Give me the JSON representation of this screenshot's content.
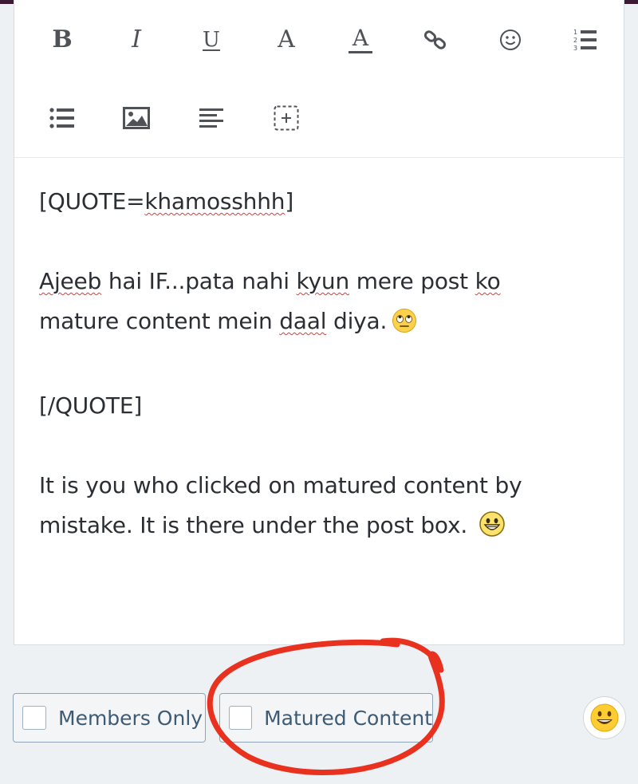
{
  "toolbar": {
    "bold": "B",
    "italic": "I",
    "underline": "U",
    "font_size": "A",
    "text_color": "A"
  },
  "content": {
    "quote_open_prefix": "[QUOTE=",
    "quote_user": "khamosshhh",
    "quote_open_suffix": "]",
    "line1_w1": "Ajeeb",
    "line1_t1": " hai IF...pata nahi ",
    "line1_w2": "kyun",
    "line1_t2": " mere post ",
    "line1_w3": "ko",
    "line2_t1": "mature content mein ",
    "line2_w1": "daal",
    "line2_t2": " diya.",
    "quote_close": "[/QUOTE]",
    "reply_line1": "It is you who clicked on matured content by",
    "reply_line2": "mistake. It is there under the post box."
  },
  "options": {
    "members_only_label": "Members Only",
    "matured_content_label": "Matured Content"
  },
  "colors": {
    "accent_border": "#8fa4b6",
    "annotation_red": "#e8321f",
    "spellcheck_red": "#e53935",
    "top_bar": "#3b1a33"
  },
  "icons": [
    "bold-icon",
    "italic-icon",
    "underline-icon",
    "font-size-icon",
    "text-color-icon",
    "link-icon",
    "smiley-icon",
    "ordered-list-icon",
    "bullet-list-icon",
    "image-icon",
    "align-icon",
    "insert-box-icon",
    "rolling-eyes-emoji",
    "grin-emoji",
    "emoji-picker-icon"
  ]
}
